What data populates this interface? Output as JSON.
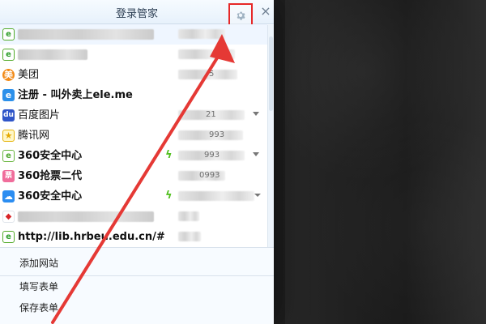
{
  "window": {
    "title": "登录管家",
    "settings_icon": "gear-icon",
    "close_label": "×"
  },
  "site_list": [
    {
      "name": "",
      "icon": "ie-icon",
      "account": ""
    },
    {
      "name": "",
      "icon": "ie-icon",
      "account": ""
    },
    {
      "name": "美团",
      "icon": "meituan-icon",
      "account": "5"
    },
    {
      "name": "注册 - 叫外卖上ele.me",
      "icon": "register-icon",
      "account": ""
    },
    {
      "name": "百度图片",
      "icon": "baidu-icon",
      "account": "21"
    },
    {
      "name": "腾讯网",
      "icon": "tencent-icon",
      "account": "993"
    },
    {
      "name": "360安全中心",
      "icon": "360-icon",
      "account": "993"
    },
    {
      "name": "360抢票二代",
      "icon": "ticket-icon",
      "account": "0993"
    },
    {
      "name": "360安全中心",
      "icon": "cloud-icon",
      "account": ""
    },
    {
      "name": "",
      "icon": "flag-icon",
      "account": ""
    },
    {
      "name": "http://lib.hrbeu.edu.cn/#",
      "icon": "ie-icon",
      "account": ""
    }
  ],
  "footer": {
    "add_site": "添加网站",
    "fill_form": "填写表单",
    "save_form": "保存表单"
  },
  "colors": {
    "highlight_border": "#e62828",
    "arrow": "#e53935"
  }
}
